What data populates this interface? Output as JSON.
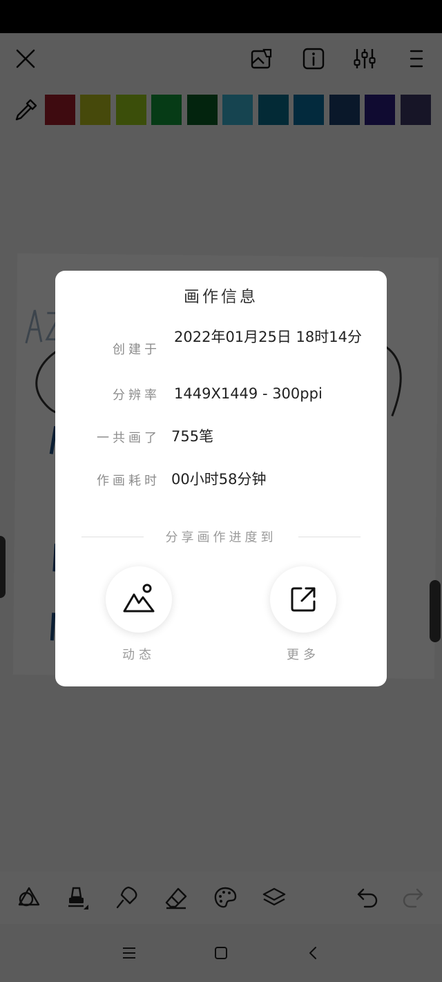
{
  "toolbar": {
    "icons": [
      "close-icon",
      "gallery-icon",
      "info-icon",
      "adjust-icon",
      "menu-icon"
    ]
  },
  "palette": {
    "colors": [
      "#a31f2b",
      "#b9c11f",
      "#9ccd1c",
      "#119c3a",
      "#085f25",
      "#3ab4d2",
      "#0a6f8f",
      "#0a6ea0",
      "#1b3f6e",
      "#2a1e80",
      "#3e3766"
    ]
  },
  "dialog": {
    "title": "画作信息",
    "created_label": "创建于",
    "created_value": "2022年01月25日 18时14分",
    "resolution_label": "分辨率",
    "resolution_value": "1449X1449 - 300ppi",
    "strokes_label": "一共画了",
    "strokes_value": "755笔",
    "duration_label": "作画耗时",
    "duration_value": "00小时58分钟",
    "share_heading": "分享画作进度到",
    "share_feed_label": "动态",
    "share_more_label": "更多"
  },
  "bottom_toolbar": {
    "icons": [
      "shapes-icon",
      "brush-icon",
      "smudge-icon",
      "eraser-icon",
      "palette-icon",
      "layers-icon",
      "undo-icon",
      "redo-icon"
    ]
  },
  "nav": {
    "icons": [
      "recents-icon",
      "home-icon",
      "back-icon"
    ]
  }
}
